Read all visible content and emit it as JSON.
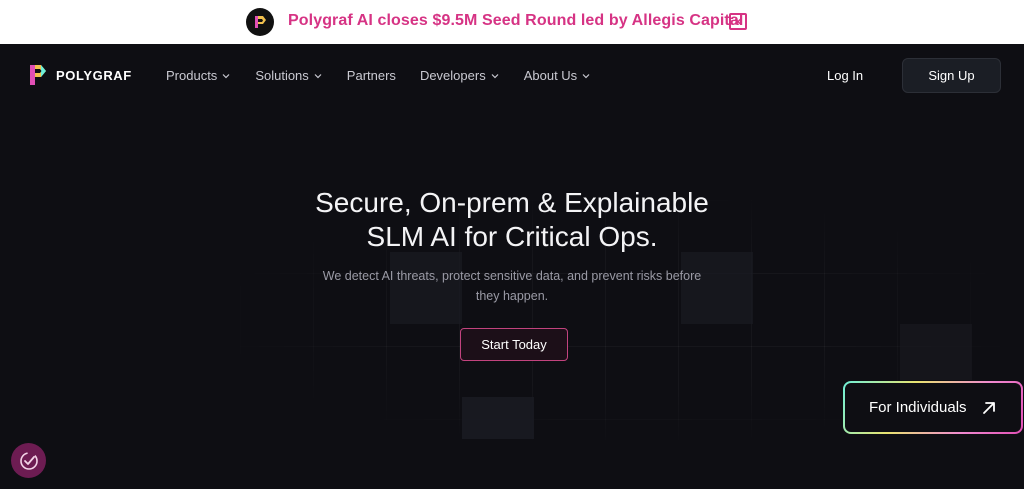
{
  "announcement": {
    "text": "Polygraf AI closes $9.5M Seed Round led by Allegis Capital",
    "close_icon": "close-icon",
    "close_glyph": "×"
  },
  "nav": {
    "brand": "POLYGRAF",
    "items": [
      {
        "label": "Products",
        "has_dropdown": true
      },
      {
        "label": "Solutions",
        "has_dropdown": true
      },
      {
        "label": "Partners",
        "has_dropdown": false
      },
      {
        "label": "Developers",
        "has_dropdown": true
      },
      {
        "label": "About Us",
        "has_dropdown": true
      }
    ],
    "login": "Log In",
    "signup": "Sign Up"
  },
  "hero": {
    "title_line1": "Secure, On-prem & Explainable",
    "title_line2": "SLM AI for Critical Ops.",
    "subtitle_line1": "We detect AI threats, protect sensitive data, and prevent risks before",
    "subtitle_line2": "they happen.",
    "cta": "Start Today"
  },
  "floating": {
    "individuals_label": "For Individuals",
    "individuals_icon": "arrow-up-right-icon",
    "cookie_icon": "cookie-consent-icon"
  },
  "colors": {
    "accent_pink": "#d63384",
    "background": "#0e0e13",
    "cta_border": "#c2437e"
  }
}
